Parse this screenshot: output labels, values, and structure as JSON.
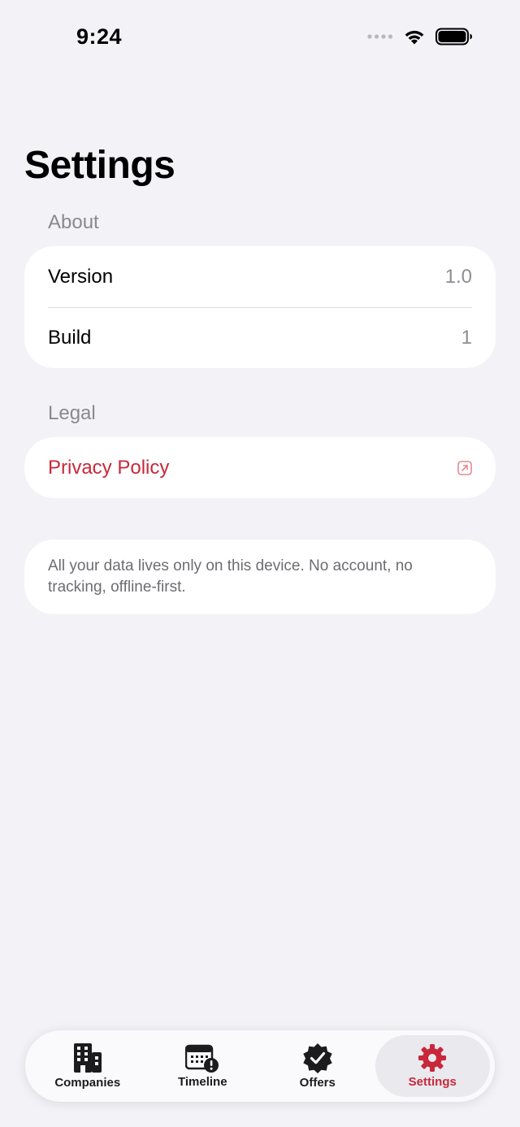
{
  "status_bar": {
    "time": "9:24"
  },
  "page": {
    "title": "Settings"
  },
  "about": {
    "header": "About",
    "rows": [
      {
        "label": "Version",
        "value": "1.0"
      },
      {
        "label": "Build",
        "value": "1"
      }
    ]
  },
  "legal": {
    "header": "Legal",
    "privacy_label": "Privacy Policy",
    "privacy_icon": "external-link-icon"
  },
  "note": {
    "text": "All your data lives only on this device. No account, no tracking, offline-first."
  },
  "tabbar": {
    "tabs": [
      {
        "label": "Companies",
        "icon": "building-icon",
        "active": false
      },
      {
        "label": "Timeline",
        "icon": "calendar-alert-icon",
        "active": false
      },
      {
        "label": "Offers",
        "icon": "checkmark-seal-icon",
        "active": false
      },
      {
        "label": "Settings",
        "icon": "gear-icon",
        "active": true
      }
    ]
  },
  "colors": {
    "accent": "#c8283a",
    "background": "#f2f2f7",
    "card": "#ffffff",
    "secondary_text": "#8e8e93"
  }
}
